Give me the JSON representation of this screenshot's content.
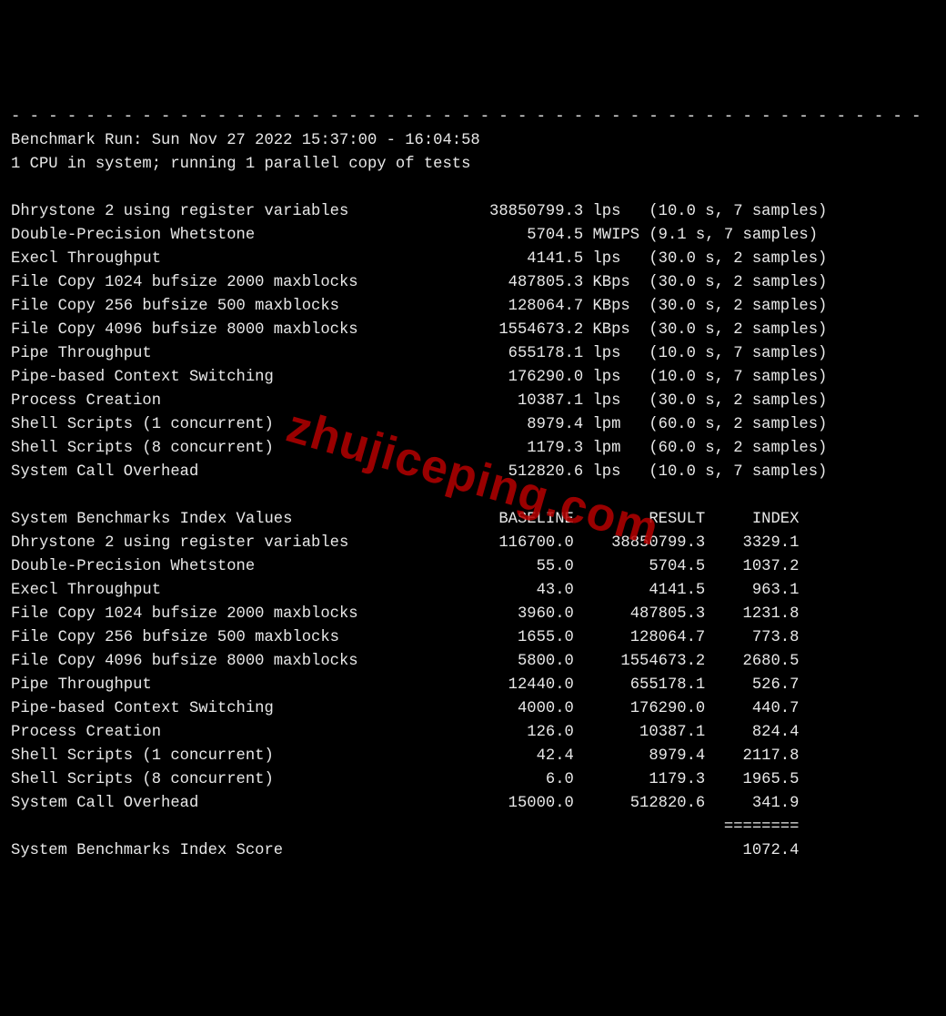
{
  "divider": "- - - - - - - - - - - - - - - - - - - - - - - - - - - - - - - - - - - - - - - - - - - - - - - - -",
  "run_line": "Benchmark Run: Sun Nov 27 2022 15:37:00 - 16:04:58",
  "cpu_line": "1 CPU in system; running 1 parallel copy of tests",
  "index_header": "System Benchmarks Index Values",
  "col_baseline": "BASELINE",
  "col_result": "RESULT",
  "col_index": "INDEX",
  "score_label": "System Benchmarks Index Score",
  "score_value": "1072.4",
  "tests": [
    {
      "name": "Dhrystone 2 using register variables",
      "value": "38850799.3",
      "unit": "lps",
      "time": "10.0",
      "samples": "7"
    },
    {
      "name": "Double-Precision Whetstone",
      "value": "5704.5",
      "unit": "MWIPS",
      "time": "9.1",
      "samples": "7"
    },
    {
      "name": "Execl Throughput",
      "value": "4141.5",
      "unit": "lps",
      "time": "30.0",
      "samples": "2"
    },
    {
      "name": "File Copy 1024 bufsize 2000 maxblocks",
      "value": "487805.3",
      "unit": "KBps",
      "time": "30.0",
      "samples": "2"
    },
    {
      "name": "File Copy 256 bufsize 500 maxblocks",
      "value": "128064.7",
      "unit": "KBps",
      "time": "30.0",
      "samples": "2"
    },
    {
      "name": "File Copy 4096 bufsize 8000 maxblocks",
      "value": "1554673.2",
      "unit": "KBps",
      "time": "30.0",
      "samples": "2"
    },
    {
      "name": "Pipe Throughput",
      "value": "655178.1",
      "unit": "lps",
      "time": "10.0",
      "samples": "7"
    },
    {
      "name": "Pipe-based Context Switching",
      "value": "176290.0",
      "unit": "lps",
      "time": "10.0",
      "samples": "7"
    },
    {
      "name": "Process Creation",
      "value": "10387.1",
      "unit": "lps",
      "time": "30.0",
      "samples": "2"
    },
    {
      "name": "Shell Scripts (1 concurrent)",
      "value": "8979.4",
      "unit": "lpm",
      "time": "60.0",
      "samples": "2"
    },
    {
      "name": "Shell Scripts (8 concurrent)",
      "value": "1179.3",
      "unit": "lpm",
      "time": "60.0",
      "samples": "2"
    },
    {
      "name": "System Call Overhead",
      "value": "512820.6",
      "unit": "lps",
      "time": "10.0",
      "samples": "7"
    }
  ],
  "index_rows": [
    {
      "name": "Dhrystone 2 using register variables",
      "baseline": "116700.0",
      "result": "38850799.3",
      "index": "3329.1"
    },
    {
      "name": "Double-Precision Whetstone",
      "baseline": "55.0",
      "result": "5704.5",
      "index": "1037.2"
    },
    {
      "name": "Execl Throughput",
      "baseline": "43.0",
      "result": "4141.5",
      "index": "963.1"
    },
    {
      "name": "File Copy 1024 bufsize 2000 maxblocks",
      "baseline": "3960.0",
      "result": "487805.3",
      "index": "1231.8"
    },
    {
      "name": "File Copy 256 bufsize 500 maxblocks",
      "baseline": "1655.0",
      "result": "128064.7",
      "index": "773.8"
    },
    {
      "name": "File Copy 4096 bufsize 8000 maxblocks",
      "baseline": "5800.0",
      "result": "1554673.2",
      "index": "2680.5"
    },
    {
      "name": "Pipe Throughput",
      "baseline": "12440.0",
      "result": "655178.1",
      "index": "526.7"
    },
    {
      "name": "Pipe-based Context Switching",
      "baseline": "4000.0",
      "result": "176290.0",
      "index": "440.7"
    },
    {
      "name": "Process Creation",
      "baseline": "126.0",
      "result": "10387.1",
      "index": "824.4"
    },
    {
      "name": "Shell Scripts (1 concurrent)",
      "baseline": "42.4",
      "result": "8979.4",
      "index": "2117.8"
    },
    {
      "name": "Shell Scripts (8 concurrent)",
      "baseline": "6.0",
      "result": "1179.3",
      "index": "1965.5"
    },
    {
      "name": "System Call Overhead",
      "baseline": "15000.0",
      "result": "512820.6",
      "index": "341.9"
    }
  ],
  "rule": "========",
  "watermark": "zhujiceping.com"
}
